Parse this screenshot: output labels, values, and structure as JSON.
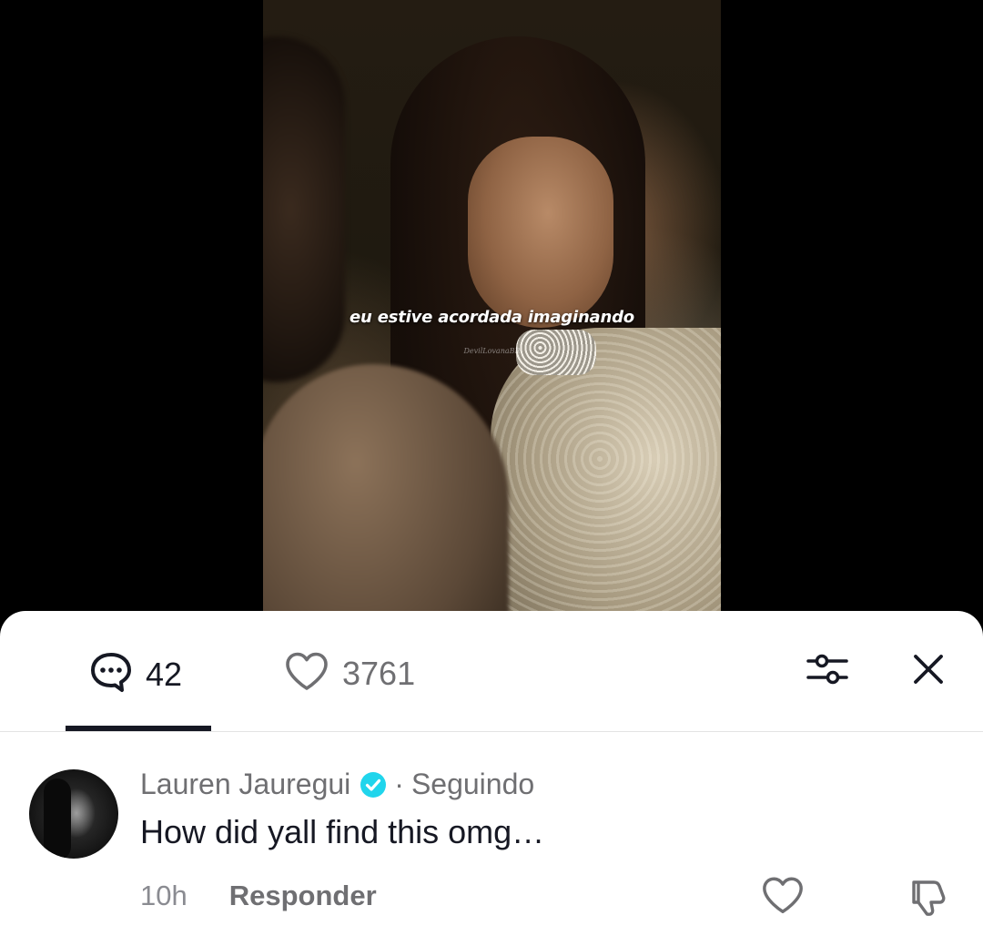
{
  "video": {
    "caption": "eu estive acordada imaginando",
    "watermark": "DevilLovanaBR"
  },
  "toolbar": {
    "comments_count": "42",
    "likes_count": "3761",
    "active_tab": "comments"
  },
  "comment": {
    "author": "Lauren Jauregui",
    "verified": true,
    "separator": "·",
    "follow_status": "Seguindo",
    "text": "How did yall find this omg…",
    "time": "10h",
    "reply_label": "Responder"
  },
  "colors": {
    "text_primary": "#161823",
    "text_secondary": "#6f6f72",
    "verified_badge": "#20d5ec",
    "sheet_bg": "#ffffff"
  }
}
